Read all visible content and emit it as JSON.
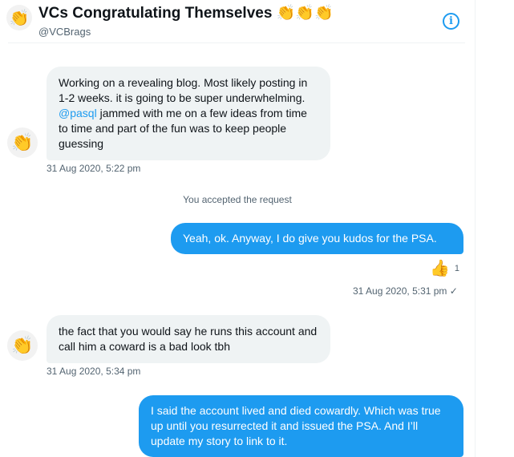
{
  "header": {
    "avatar_emoji": "👏",
    "title": "VCs Congratulating Themselves",
    "title_claps": "👏👏👏",
    "handle": "@VCBrags",
    "info_icon": "info-icon"
  },
  "messages": [
    {
      "direction": "in",
      "avatar_emoji": "👏",
      "text_before": "Working on a revealing blog. Most likely posting in 1-2 weeks. it is going to be super underwhelming.  ",
      "mention": "@pasql",
      "text_after": " jammed with me on a few ideas from time to time and part of the fun was to keep people guessing",
      "time": "31 Aug 2020, 5:22 pm"
    },
    {
      "direction": "system",
      "text": "You accepted the request"
    },
    {
      "direction": "out",
      "text": "Yeah, ok. Anyway, I do give you kudos for the PSA.",
      "reaction": {
        "emoji": "👍",
        "count": "1"
      },
      "time": "31 Aug 2020, 5:31 pm",
      "read_mark": "✓"
    },
    {
      "direction": "in",
      "avatar_emoji": "👏",
      "text": "the fact that you would say he runs this account and call him a coward is a bad look tbh",
      "time": "31 Aug 2020, 5:34 pm"
    },
    {
      "direction": "out",
      "text": "I said the account lived and died cowardly. Which was true up until you resurrected it and issued the PSA. And I’ll update my story to link to it."
    }
  ],
  "colors": {
    "accent": "#1d9bf0",
    "incoming_bubble": "#eff3f4",
    "muted_text": "#536471"
  }
}
